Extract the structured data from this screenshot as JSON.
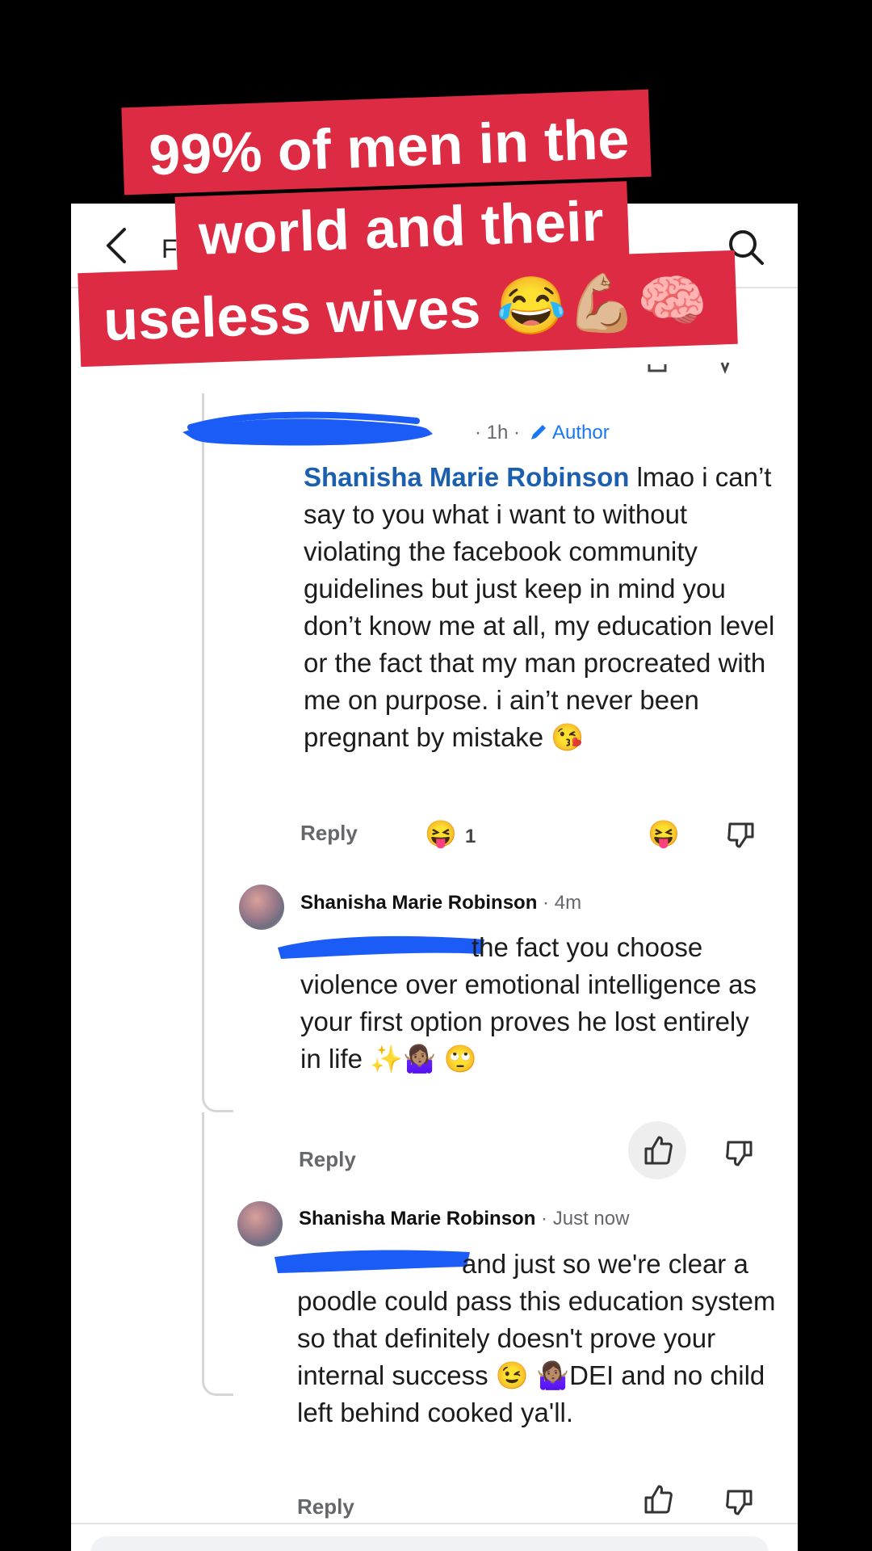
{
  "overlay": {
    "line1": "99% of men in the",
    "line2": "world and their",
    "line3": "useless wives 😂💪🏼🧠"
  },
  "header": {
    "partial_title": "F"
  },
  "comment1": {
    "time": "· 1h ·",
    "author_badge": "Author",
    "mention": "Shanisha Marie Robinson",
    "text": " lmao i can’t say to you what i want to without violating the facebook community guidelines but just keep in mind you don’t know me at all, my education level or the fact that my man procreated with me on purpose. i ain’t never been pregnant by mistake 😘",
    "reply_label": "Reply",
    "reaction_emoji": "😝",
    "reaction_count": "1",
    "action_emoji": "😝"
  },
  "comment2": {
    "name": "Shanisha Marie Robinson",
    "time": " · 4m",
    "text": "the fact you choose violence over emotional intelligence as your first option proves he lost entirely in life ✨🤷🏽‍♀️ 🙄",
    "reply_label": "Reply"
  },
  "comment3": {
    "name": "Shanisha Marie Robinson",
    "time": " · Just now",
    "text": "and just so we're clear a poodle could pass this education system so that definitely doesn't prove your internal success 😉 🤷🏽‍♀️DEI and no child left behind cooked ya'll.",
    "reply_label": "Reply"
  },
  "colors": {
    "banner": "#dc2b42",
    "mention": "#1b5fae",
    "redaction": "#1a5cf5",
    "link_blue": "#1877f2"
  },
  "icons": [
    "back-chevron-icon",
    "search-icon",
    "pencil-icon",
    "like-icon",
    "dislike-icon"
  ]
}
